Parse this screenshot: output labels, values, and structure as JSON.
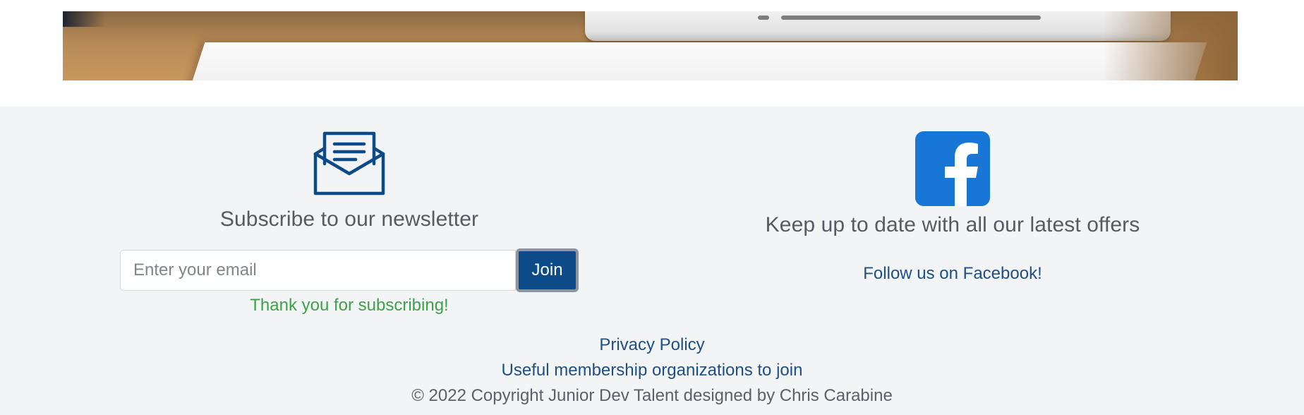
{
  "newsletter": {
    "heading": "Subscribe to our newsletter",
    "email_placeholder": "Enter your email",
    "join_label": "Join",
    "success_message": "Thank you for subscribing!",
    "icon": "envelope-open-icon"
  },
  "social": {
    "heading": "Keep up to date with all our latest offers",
    "facebook_link": "Follow us on Facebook!",
    "icon": "facebook-icon"
  },
  "footer_links": {
    "privacy": "Privacy Policy",
    "organizations": "Useful membership organizations to join"
  },
  "copyright": "© 2022 Copyright Junior Dev Talent designed by Chris Carabine",
  "colors": {
    "brand_blue": "#0c4a88",
    "facebook_blue": "#1877d6",
    "success_green": "#3fa04a",
    "footer_bg": "#f3f4f6"
  }
}
